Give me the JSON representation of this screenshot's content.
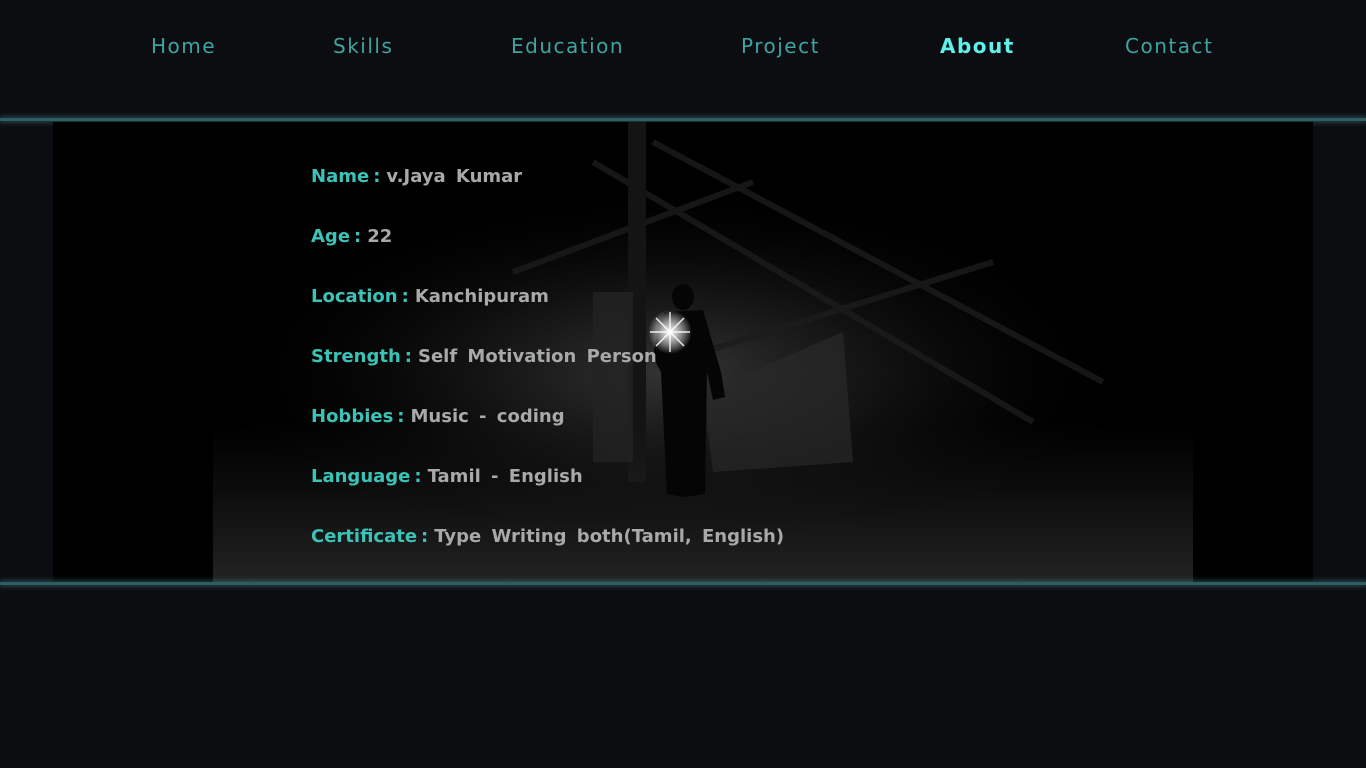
{
  "nav": {
    "items": [
      {
        "label": "Home"
      },
      {
        "label": "Skills"
      },
      {
        "label": "Education"
      },
      {
        "label": "Project"
      },
      {
        "label": "About",
        "active": true
      },
      {
        "label": "Contact"
      }
    ]
  },
  "about": {
    "separator": ":",
    "rows": [
      {
        "key": "Name",
        "value": "v.Jaya Kumar"
      },
      {
        "key": "Age",
        "value": "22"
      },
      {
        "key": "Location",
        "value": "Kanchipuram"
      },
      {
        "key": "Strength",
        "value": "Self Motivation Person"
      },
      {
        "key": "Hobbies",
        "value": "Music - coding"
      },
      {
        "key": "Language",
        "value": "Tamil - English"
      },
      {
        "key": "Certificate",
        "value": "Type Writing both(Tamil, English)"
      }
    ]
  },
  "colors": {
    "page_background": "#0b0d11",
    "nav_text": "#3fa3a0",
    "nav_active": "#5ef2ea",
    "info_key": "#3cc3b8",
    "info_value": "#a7a9ab",
    "glow_line": "#2f5d61"
  },
  "icons": {
    "background_image": "dark-attic-figure-with-flashlight-photo"
  }
}
